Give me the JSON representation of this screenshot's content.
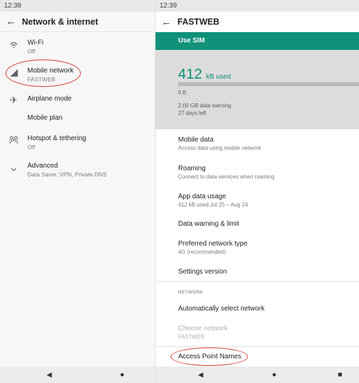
{
  "left": {
    "status_time": "12:38",
    "title": "Network & internet",
    "items": [
      {
        "icon": "wifi-icon",
        "label": "Wi-Fi",
        "sub": "Off"
      },
      {
        "icon": "signal-icon",
        "label": "Mobile network",
        "sub": "FASTWEB"
      },
      {
        "icon": "airplane-icon",
        "label": "Airplane mode",
        "sub": ""
      },
      {
        "icon": "",
        "label": "Mobile plan",
        "sub": ""
      },
      {
        "icon": "hotspot-icon",
        "label": "Hotspot & tethering",
        "sub": "Off"
      },
      {
        "icon": "chevron-down-icon",
        "label": "Advanced",
        "sub": "Data Saver, VPN, Private DNS"
      }
    ]
  },
  "right": {
    "status_time": "12:39",
    "title": "FASTWEB",
    "use_sim": "Use SIM",
    "usage": {
      "amount": "412",
      "unit": "kB used",
      "fraction_used": 0.0002,
      "scale_start": "0 B",
      "warning": "2.00 GB data warning",
      "days_left": "27 days left"
    },
    "items": [
      {
        "label": "Mobile data",
        "sub": "Access data using mobile network"
      },
      {
        "label": "Roaming",
        "sub": "Connect to data services when roaming"
      },
      {
        "label": "App data usage",
        "sub": "412 kB used Jul 25 – Aug 24"
      },
      {
        "label": "Data warning & limit",
        "sub": ""
      },
      {
        "label": "Preferred network type",
        "sub": "4G (recommended)"
      },
      {
        "label": "Settings version",
        "sub": ""
      }
    ],
    "network_section": "NETWORK",
    "network_items": [
      {
        "label": "Automatically select network",
        "sub": ""
      },
      {
        "label": "Choose network",
        "sub": "FASTWEB"
      },
      {
        "label": "Access Point Names",
        "sub": ""
      }
    ]
  },
  "colors": {
    "accent": "#0a8f77",
    "use_sim_bg": "#10917a",
    "highlight": "#d23a2a"
  }
}
